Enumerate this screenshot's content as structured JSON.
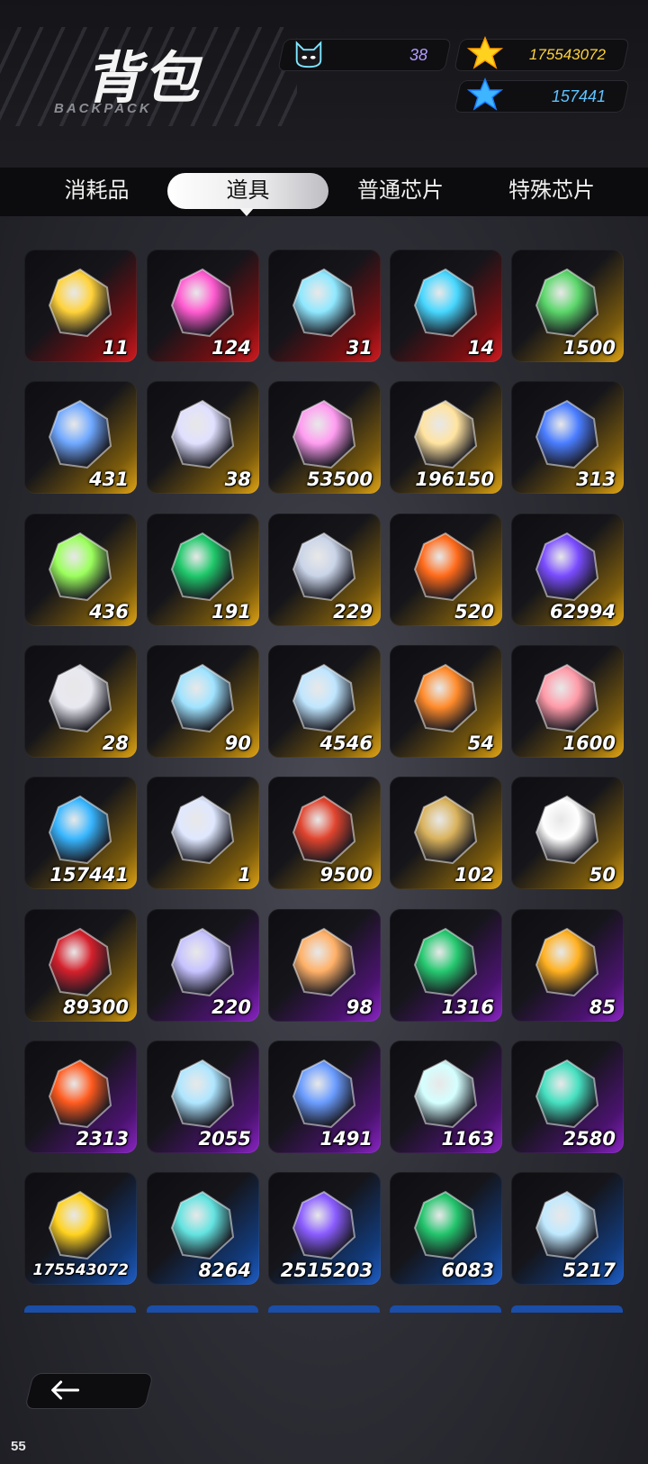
{
  "header": {
    "title": "背包",
    "subtitle": "BACKPACK",
    "currencies": [
      {
        "icon": "cat-face-icon",
        "value": "38",
        "color": "#b49cff"
      },
      {
        "icon": "gold-star-icon",
        "value": "175543072",
        "color": "#ffd23a"
      },
      {
        "icon": "blue-star-icon",
        "value": "157441",
        "color": "#5fc3ff"
      }
    ]
  },
  "tabs": [
    {
      "label": "消耗品",
      "active": false
    },
    {
      "label": "道具",
      "active": true
    },
    {
      "label": "普通芯片",
      "active": false
    },
    {
      "label": "特殊芯片",
      "active": false
    }
  ],
  "items": [
    {
      "icon": "compass-star-icon",
      "count": "11",
      "rarity": "red"
    },
    {
      "icon": "ticket-capsule-icon",
      "count": "124",
      "rarity": "red"
    },
    {
      "icon": "potion-flask-icon",
      "count": "31",
      "rarity": "red"
    },
    {
      "icon": "spiked-orb-icon",
      "count": "14",
      "rarity": "red"
    },
    {
      "icon": "rice-dumpling-icon",
      "count": "1500",
      "rarity": "gold"
    },
    {
      "icon": "crystal-shards-icon",
      "count": "431",
      "rarity": "gold"
    },
    {
      "icon": "cat-face-icon",
      "count": "38",
      "rarity": "gold"
    },
    {
      "icon": "lollipop-icon",
      "count": "53500",
      "rarity": "gold"
    },
    {
      "icon": "eye-star-icon",
      "count": "196150",
      "rarity": "gold"
    },
    {
      "icon": "blue-strawberry-icon",
      "count": "313",
      "rarity": "gold"
    },
    {
      "icon": "atom-ring-icon",
      "count": "436",
      "rarity": "gold"
    },
    {
      "icon": "green-gem-icon",
      "count": "191",
      "rarity": "gold"
    },
    {
      "icon": "mech-wing-icon",
      "count": "229",
      "rarity": "gold"
    },
    {
      "icon": "orange-flower-icon",
      "count": "520",
      "rarity": "gold"
    },
    {
      "icon": "purple-chip-icon",
      "count": "62994",
      "rarity": "gold"
    },
    {
      "icon": "silver-crown-icon",
      "count": "28",
      "rarity": "gold"
    },
    {
      "icon": "prism-cube-icon",
      "count": "90",
      "rarity": "gold"
    },
    {
      "icon": "blue-jar-icon",
      "count": "4546",
      "rarity": "gold"
    },
    {
      "icon": "lantern-icon",
      "count": "54",
      "rarity": "gold"
    },
    {
      "icon": "pink-egg-icon",
      "count": "1600",
      "rarity": "gold"
    },
    {
      "icon": "blue-star-icon",
      "count": "157441",
      "rarity": "gold"
    },
    {
      "icon": "envelope-card-icon",
      "count": "1",
      "rarity": "gold"
    },
    {
      "icon": "red-egg-icon",
      "count": "9500",
      "rarity": "gold"
    },
    {
      "icon": "gold-ticket-icon",
      "count": "102",
      "rarity": "gold"
    },
    {
      "icon": "open-book-icon",
      "count": "50",
      "rarity": "gold"
    },
    {
      "icon": "red-puzzle-icon",
      "count": "89300",
      "rarity": "gold"
    },
    {
      "icon": "capsule-tube-icon",
      "count": "220",
      "rarity": "purple"
    },
    {
      "icon": "capsule-tube-orange-icon",
      "count": "98",
      "rarity": "purple"
    },
    {
      "icon": "green-crystal-icon",
      "count": "1316",
      "rarity": "purple"
    },
    {
      "icon": "gold-emblem-icon",
      "count": "85",
      "rarity": "purple"
    },
    {
      "icon": "fire-orb-icon",
      "count": "2313",
      "rarity": "purple"
    },
    {
      "icon": "ice-crystals-icon",
      "count": "2055",
      "rarity": "purple"
    },
    {
      "icon": "blue-ore-icon",
      "count": "1491",
      "rarity": "purple"
    },
    {
      "icon": "glass-cube-icon",
      "count": "1163",
      "rarity": "purple"
    },
    {
      "icon": "teal-ring-icon",
      "count": "2580",
      "rarity": "purple"
    },
    {
      "icon": "gold-star-icon",
      "count": "175543072",
      "rarity": "blue"
    },
    {
      "icon": "teal-card-icon",
      "count": "8264",
      "rarity": "blue"
    },
    {
      "icon": "violet-chip-icon",
      "count": "2515203",
      "rarity": "blue"
    },
    {
      "icon": "small-emerald-icon",
      "count": "6083",
      "rarity": "blue"
    },
    {
      "icon": "snow-hexagon-icon",
      "count": "5217",
      "rarity": "blue"
    }
  ],
  "rarity_colors": {
    "red": "#c4161c",
    "gold": "#d69a12",
    "purple": "#7a1fb0",
    "blue": "#1a4ea8"
  },
  "footer": {
    "back_icon": "arrow-left-icon",
    "fps": "55"
  }
}
